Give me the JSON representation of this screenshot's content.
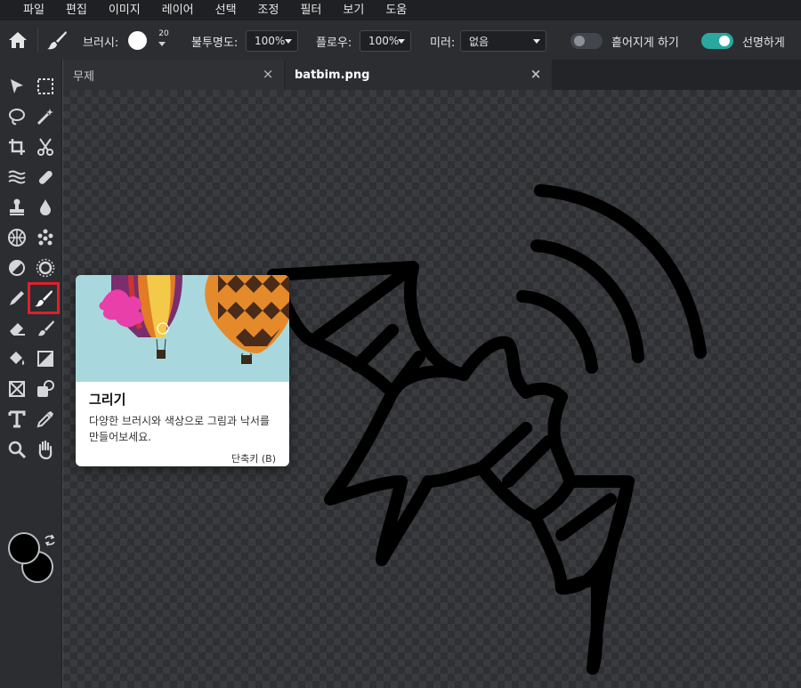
{
  "menu": [
    "파일",
    "편집",
    "이미지",
    "레이어",
    "선택",
    "조정",
    "필터",
    "보기",
    "도움"
  ],
  "toolbar": {
    "brush_label": "브러시:",
    "brush_size": "20",
    "opacity_label": "불투명도:",
    "opacity_value": "100%",
    "flow_label": "플로우:",
    "flow_value": "100%",
    "mirror_label": "미러:",
    "mirror_value": "없음",
    "scatter_label": "흩어지게 하기",
    "scatter_on": false,
    "sharp_label": "선명하게",
    "sharp_on": true
  },
  "tabs": [
    {
      "label": "무제",
      "active": false
    },
    {
      "label": "batbim.png",
      "active": true
    }
  ],
  "tools": {
    "active": "brush-tool",
    "foreground_color": "#000000",
    "background_color": "#000000"
  },
  "tooltip": {
    "title": "그리기",
    "description": "다양한 브러시와 색상으로 그림과 낙서를 만들어보세요.",
    "shortcut": "단축키 (B)"
  },
  "colors": {
    "accent": "#2aa79f",
    "active_tool_border": "#e0202a",
    "menubar": "#1f2023",
    "panel": "#2b2d31"
  }
}
